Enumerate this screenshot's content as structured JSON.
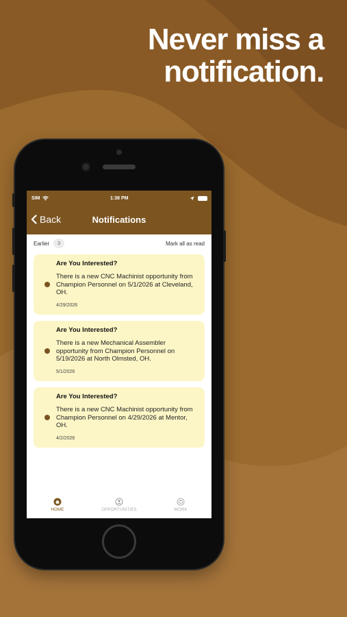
{
  "promo": {
    "line1": "Never miss a",
    "line2": "notification."
  },
  "colors": {
    "background": "#8a5a26",
    "header": "#7b5420",
    "card": "#fcf6c6",
    "dot": "#7a5322"
  },
  "status_bar": {
    "carrier": "SIM",
    "time": "1:38 PM"
  },
  "nav": {
    "back_label": "Back",
    "title": "Notifications"
  },
  "list": {
    "section_label": "Earlier",
    "count": "3",
    "mark_all_label": "Mark all as read"
  },
  "notifications": [
    {
      "title": "Are You Interested?",
      "body": "There is a new CNC Machinist opportunity from Champion Personnel on 5/1/2026 at Cleveland, OH.",
      "date": "4/29/2026"
    },
    {
      "title": "Are You Interested?",
      "body": "There is a new Mechanical Assembler opportunity from Champion Personnel on 5/19/2026 at North Olmsted, OH.",
      "date": "5/1/2026"
    },
    {
      "title": "Are You Interested?",
      "body": "There is a new CNC Machinist opportunity from Champion Personnel on 4/29/2026 at Mentor, OH.",
      "date": "4/2/2026"
    }
  ],
  "tabs": [
    {
      "label": "HOME",
      "icon": "home-icon",
      "active": true
    },
    {
      "label": "OPPORTUNITIES",
      "icon": "opportunities-icon",
      "active": false
    },
    {
      "label": "WORK",
      "icon": "work-icon",
      "active": false
    }
  ]
}
